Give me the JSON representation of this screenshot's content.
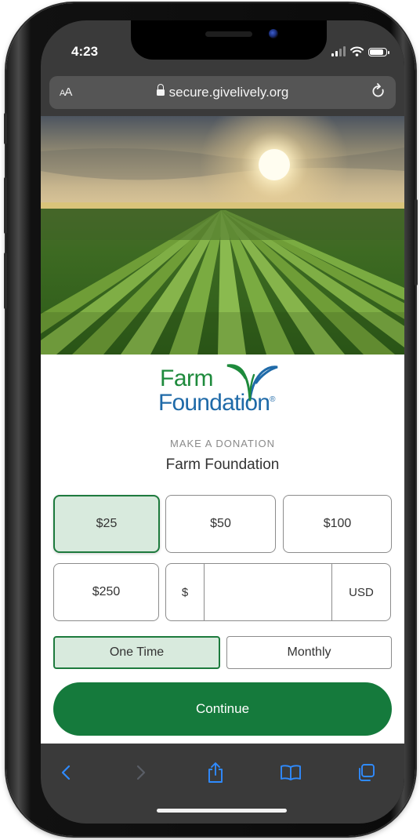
{
  "status_bar": {
    "time": "4:23"
  },
  "browser": {
    "text_size_label": "AA",
    "url": "secure.givelively.org"
  },
  "logo": {
    "line1": "Farm",
    "line2": "Foundation",
    "mark": "®"
  },
  "donation": {
    "eyebrow": "MAKE A DONATION",
    "org_name": "Farm Foundation",
    "amounts": [
      "$25",
      "$50",
      "$100",
      "$250"
    ],
    "selected_amount": "$25",
    "custom_prefix": "$",
    "custom_value": "",
    "currency": "USD",
    "frequency": {
      "one_time": "One Time",
      "monthly": "Monthly",
      "selected": "One Time"
    },
    "continue_label": "Continue"
  },
  "colors": {
    "brand_green": "#157a3c",
    "selected_fill": "#d8eadd",
    "logo_blue": "#1f6aa8",
    "safari_tint": "#2f8bff"
  },
  "toolbar": {
    "icons": [
      "back-icon",
      "forward-icon",
      "share-icon",
      "bookmarks-icon",
      "tabs-icon"
    ]
  }
}
